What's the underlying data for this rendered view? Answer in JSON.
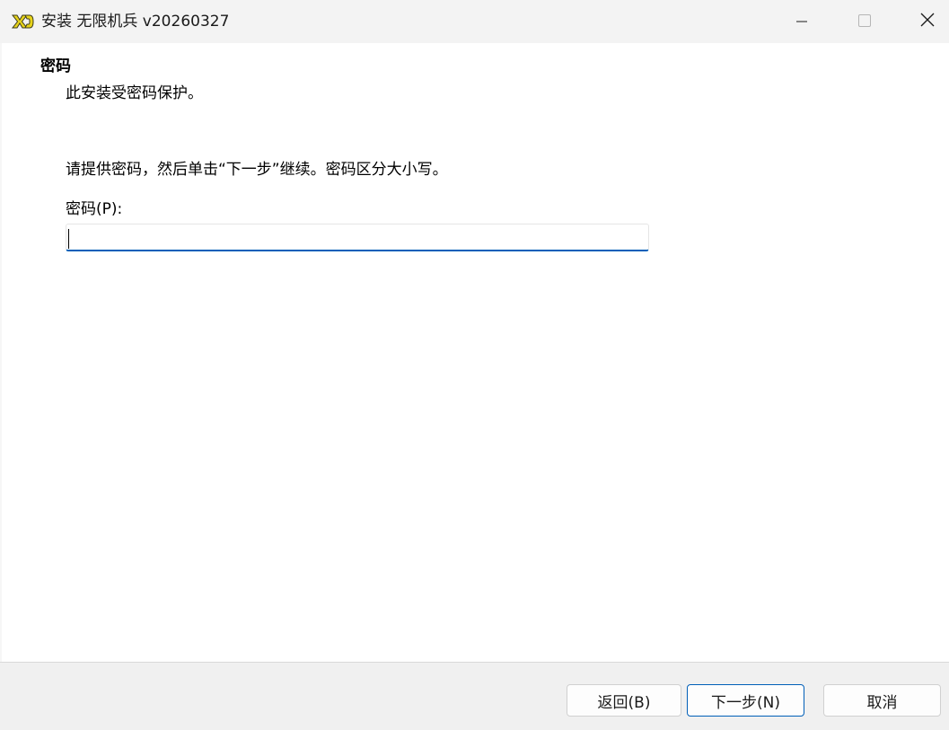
{
  "window": {
    "title": "安装 无限机兵 v20260327",
    "app_icon": "xd-logo-icon",
    "controls": {
      "minimize": "minimize-icon",
      "maximize": "maximize-icon",
      "close": "close-icon"
    }
  },
  "page": {
    "heading": "密码",
    "subheading": "此安装受密码保护。",
    "instruction": "请提供密码，然后单击“下一步”继续。密码区分大小写。",
    "password_label": "密码(P):",
    "password_value": ""
  },
  "footer": {
    "back_label": "返回(B)",
    "next_label": "下一步(N)",
    "cancel_label": "取消"
  },
  "colors": {
    "accent": "#005fb8",
    "titlebar": "#f3f3f3",
    "footer": "#f0f0f0",
    "logo": "#e6d21a"
  }
}
